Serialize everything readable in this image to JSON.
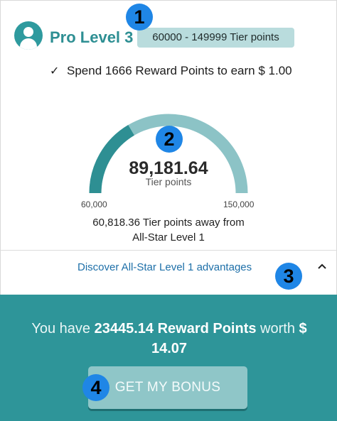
{
  "level": {
    "title": "Pro Level 3",
    "tier_range": "60000 - 149999 Tier points"
  },
  "spend_info": "Spend 1666 Reward Points to earn $ 1.00",
  "gauge": {
    "value": "89,181.64",
    "caption": "Tier points",
    "min": "60,000",
    "max": "150,000",
    "progress": 0.33,
    "track_color": "#8cc3c6",
    "fill_color": "#2e8f93"
  },
  "away": {
    "line1": "60,818.36 Tier points away from",
    "line2": "All-Star Level 1"
  },
  "discover_link": "Discover All-Star Level 1 advantages",
  "reward": {
    "prefix": "You have",
    "points": "23445.14 Reward Points",
    "middle": "worth",
    "amount_part1": "$",
    "amount_part2": "14.07"
  },
  "bonus_button": "GET MY BONUS",
  "badges": [
    "1",
    "2",
    "3",
    "4"
  ],
  "colors": {
    "accent": "#2e9599",
    "badge": "#1f86e6",
    "link": "#1d6fa8"
  }
}
